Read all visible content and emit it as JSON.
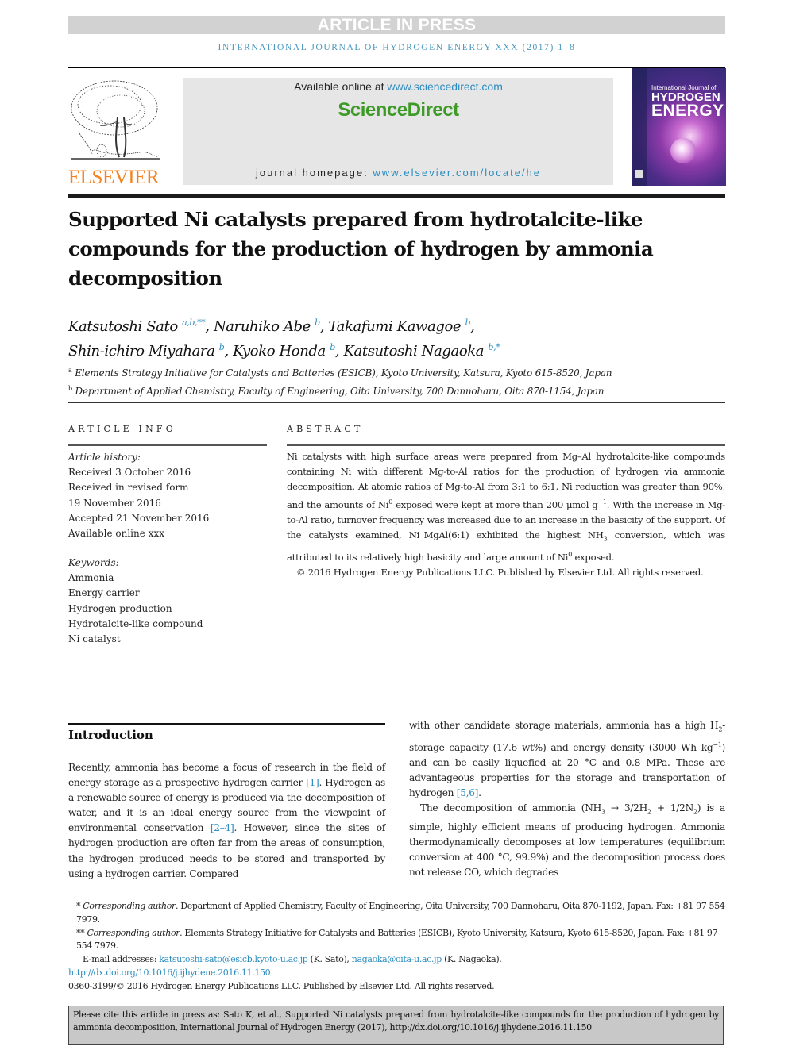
{
  "banner": {
    "article_in_press": "ARTICLE IN PRESS",
    "journal_line": "International Journal of Hydrogen Energy xxx (2017) 1–8"
  },
  "header": {
    "publisher_logo_text": "ELSEVIER",
    "available_online_prefix": "Available online at ",
    "sciencedirect_url": "www.sciencedirect.com",
    "sciencedirect_brand": "ScienceDirect",
    "homepage_prefix": "journal homepage: ",
    "homepage_url": "www.elsevier.com/locate/he",
    "cover": {
      "line1": "International Journal of",
      "line2": "HYDROGEN",
      "line3": "ENERGY"
    }
  },
  "article": {
    "title": "Supported Ni catalysts prepared from hydrotalcite-like compounds for the production of hydrogen by ammonia decomposition",
    "authors": [
      {
        "name": "Katsutoshi Sato",
        "marks": "a,b,**",
        "sep": ", "
      },
      {
        "name": "Naruhiko Abe",
        "marks": "b",
        "sep": ", "
      },
      {
        "name": "Takafumi Kawagoe",
        "marks": "b",
        "sep": ","
      },
      {
        "name": "Shin-ichiro Miyahara",
        "marks": "b",
        "sep": ", "
      },
      {
        "name": "Kyoko Honda",
        "marks": "b",
        "sep": ", "
      },
      {
        "name": "Katsutoshi Nagaoka",
        "marks": "b,*",
        "sep": ""
      }
    ],
    "affiliations": [
      {
        "mark": "a",
        "text": "Elements Strategy Initiative for Catalysts and Batteries (ESICB), Kyoto University, Katsura, Kyoto 615-8520, Japan"
      },
      {
        "mark": "b",
        "text": "Department of Applied Chemistry, Faculty of Engineering, Oita University, 700 Dannoharu, Oita 870-1154, Japan"
      }
    ]
  },
  "article_info": {
    "heading": "ARTICLE INFO",
    "history_label": "Article history:",
    "history": [
      "Received 3 October 2016",
      "Received in revised form",
      "19 November 2016",
      "Accepted 21 November 2016",
      "Available online xxx"
    ],
    "keywords_label": "Keywords:",
    "keywords": [
      "Ammonia",
      "Energy carrier",
      "Hydrogen production",
      "Hydrotalcite-like compound",
      "Ni catalyst"
    ]
  },
  "abstract": {
    "heading": "ABSTRACT",
    "p1_a": "Ni catalysts with high surface areas were prepared from Mg–Al hydrotalcite-like compounds containing Ni with different Mg-to-Al ratios for the production of hydrogen via ammonia decomposition. At atomic ratios of Mg-to-Al from 3:1 to 6:1, Ni reduction was greater than 90%, and the amounts of Ni",
    "p1_sup1": "0",
    "p1_b": " exposed were kept at more than 200 μmol g",
    "p1_sup2": "−1",
    "p1_c": ". With the increase in Mg-to-Al ratio, turnover frequency was increased due to an increase in the basicity of the support. Of the catalysts examined, Ni_MgAl(6:1) exhibited the highest NH",
    "p1_sub1": "3",
    "p1_d": " conversion, which was attributed to its relatively high basicity and large amount of Ni",
    "p1_sup3": "0",
    "p1_e": " exposed.",
    "copyright": "© 2016 Hydrogen Energy Publications LLC. Published by Elsevier Ltd. All rights reserved."
  },
  "body": {
    "section_heading": "Introduction",
    "left": {
      "t1": "Recently, ammonia has become a focus of research in the field of energy storage as a prospective hydrogen carrier ",
      "ref1": "[1]",
      "t2": ". Hydrogen as a renewable source of energy is produced via the decomposition of water, and it is an ideal energy source from the viewpoint of environmental conservation ",
      "ref2": "[2–4]",
      "t3": ". However, since the sites of hydrogen production are often far from the areas of consumption, the hydrogen produced needs to be stored and transported by using a hydrogen carrier. Compared"
    },
    "right": {
      "p1_a": "with other candidate storage materials, ammonia has a high H",
      "p1_sub1": "2",
      "p1_b": "-storage capacity (17.6 wt%) and energy density (3000 Wh kg",
      "p1_sup1": "−1",
      "p1_c": ") and can be easily liquefied at 20 °C and 0.8 MPa. These are advantageous properties for the storage and transportation of hydrogen ",
      "ref1": "[5,6]",
      "p1_d": ".",
      "p2_a": "The decomposition of ammonia (NH",
      "p2_sub1": "3",
      "p2_b": " → 3/2H",
      "p2_sub2": "2",
      "p2_c": " + 1/2N",
      "p2_sub3": "2",
      "p2_d": ") is a simple, highly efficient means of producing hydrogen. Ammonia thermodynamically decomposes at low temperatures (equilibrium conversion at 400 °C, 99.9%) and the decomposition process does not release CO, which degrades"
    }
  },
  "footnotes": {
    "fn1_mark": "* ",
    "fn1_label": "Corresponding author",
    "fn1_text": ". Department of Applied Chemistry, Faculty of Engineering, Oita University, 700 Dannoharu, Oita 870-1192, Japan. Fax: +81 97 554 7979.",
    "fn2_mark": "** ",
    "fn2_label": "Corresponding author",
    "fn2_text": ". Elements Strategy Initiative for Catalysts and Batteries (ESICB), Kyoto University, Katsura, Kyoto 615-8520, Japan. Fax: +81 97 554 7979.",
    "email_label": "E-mail addresses: ",
    "email1": "katsutoshi-sato@esicb.kyoto-u.ac.jp",
    "email1_who": " (K. Sato), ",
    "email2": "nagaoka@oita-u.ac.jp",
    "email2_who": " (K. Nagaoka).",
    "doi": "http://dx.doi.org/10.1016/j.ijhydene.2016.11.150",
    "issn_copyright": "0360-3199/© 2016 Hydrogen Energy Publications LLC. Published by Elsevier Ltd. All rights reserved."
  },
  "citation_box": {
    "text": "Please cite this article in press as: Sato K, et al., Supported Ni catalysts prepared from hydrotalcite-like compounds for the production of hydrogen by ammonia decomposition, International Journal of Hydrogen Energy (2017), http://dx.doi.org/10.1016/j.ijhydene.2016.11.150"
  },
  "colors": {
    "link": "#2a8cc0",
    "sciencedirect_green": "#3e9a26",
    "elsevier_orange": "#f58220",
    "banner_gray": "#d2d2d2",
    "journal_line": "#4a97bd"
  }
}
